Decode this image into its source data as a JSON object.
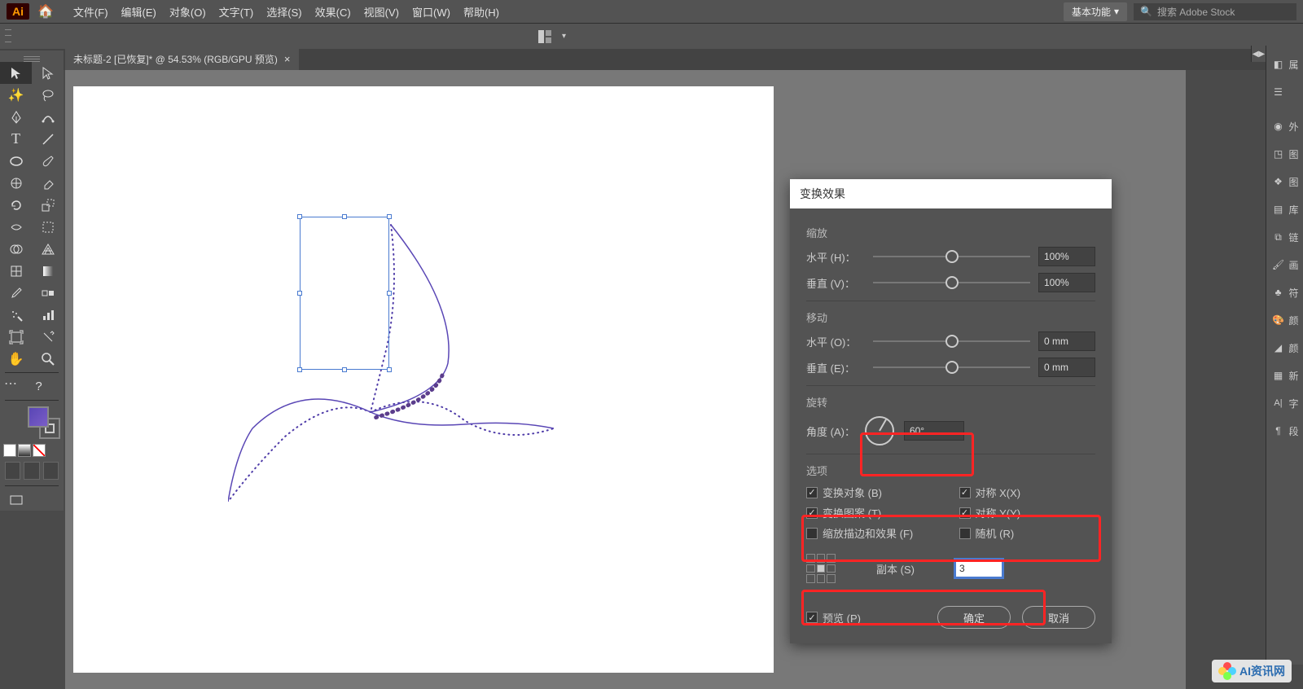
{
  "app": {
    "logo": "Ai"
  },
  "menu": {
    "items": [
      "文件(F)",
      "编辑(E)",
      "对象(O)",
      "文字(T)",
      "选择(S)",
      "效果(C)",
      "视图(V)",
      "窗口(W)",
      "帮助(H)"
    ],
    "workspace": "基本功能",
    "search_placeholder": "搜索 Adobe Stock"
  },
  "tab": {
    "title": "未标题-2 [已恢复]* @ 54.53% (RGB/GPU 预览)"
  },
  "right_panels": [
    "属",
    "外",
    "图",
    "图",
    "库",
    "链",
    "画",
    "符",
    "颜",
    "颜",
    "新",
    "字",
    "段"
  ],
  "dialog": {
    "title": "变换效果",
    "scale": {
      "label": "缩放",
      "h_label": "水平 (H)：",
      "v_label": "垂直 (V)：",
      "h_val": "100%",
      "v_val": "100%"
    },
    "move": {
      "label": "移动",
      "h_label": "水平 (O)：",
      "v_label": "垂直 (E)：",
      "h_val": "0 mm",
      "v_val": "0 mm"
    },
    "rotate": {
      "label": "旋转",
      "angle_label": "角度 (A)：",
      "angle_val": "60°"
    },
    "options": {
      "label": "选项",
      "transform_obj": "变换对象 (B)",
      "transform_pat": "变换图案 (T)",
      "scale_stroke": "缩放描边和效果 (F)",
      "reflect_x": "对称 X(X)",
      "reflect_y": "对称 Y(Y)",
      "random": "随机 (R)"
    },
    "copies": {
      "label": "副本 (S)",
      "value": "3"
    },
    "preview": "预览 (P)",
    "ok": "确定",
    "cancel": "取消"
  },
  "watermark": {
    "text": "AI资讯网"
  }
}
